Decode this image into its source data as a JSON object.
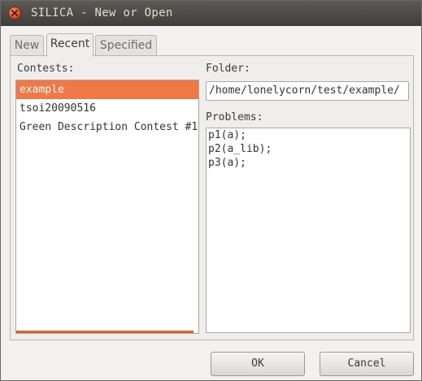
{
  "window": {
    "title": "SILICA - New or Open"
  },
  "tabs": [
    {
      "label": "New",
      "active": false
    },
    {
      "label": "Recent",
      "active": true
    },
    {
      "label": "Specified",
      "active": false
    }
  ],
  "recent": {
    "contests_label": "Contests:",
    "contests": [
      "example",
      "tsoi20090516",
      "Green Description Contest #1"
    ],
    "selected_index": 0,
    "folder_label": "Folder:",
    "folder_value": "/home/lonelycorn/test/example/",
    "problems_label": "Problems:",
    "problems": [
      "p1(a);",
      "p2(a_lib);",
      "p3(a);"
    ]
  },
  "buttons": {
    "ok": "OK",
    "cancel": "Cancel"
  },
  "colors": {
    "accent": "#f07746",
    "titlebar": "#3f3e3b",
    "close": "#d9441b"
  }
}
